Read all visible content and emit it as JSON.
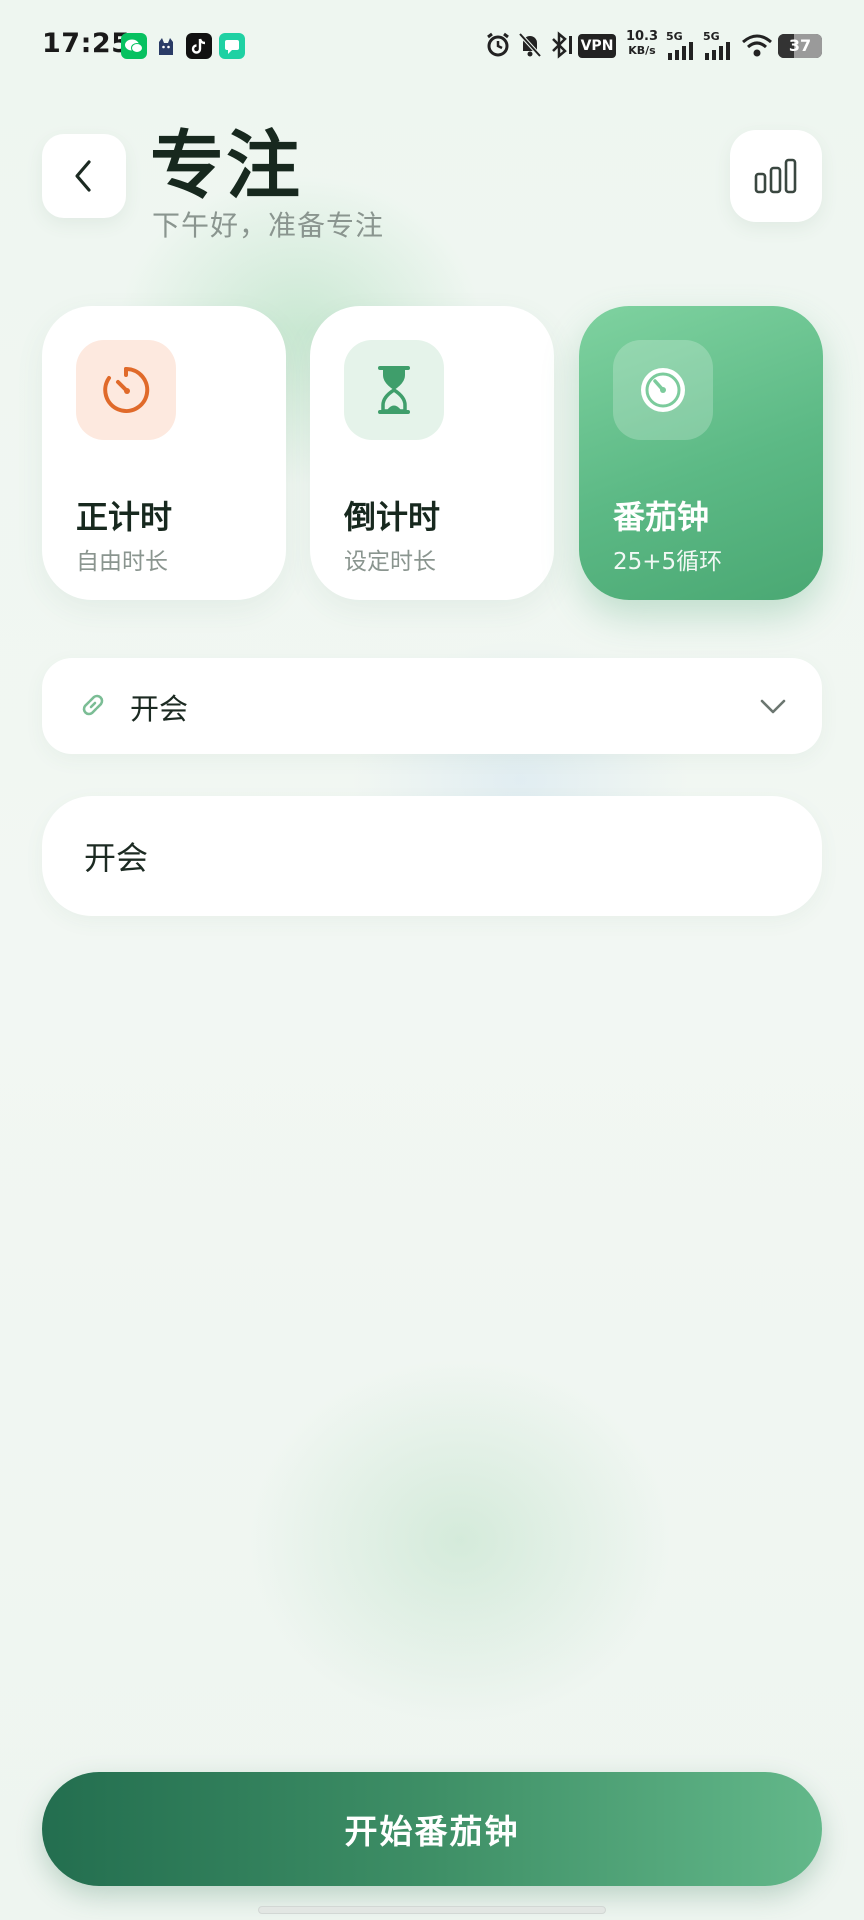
{
  "status_bar": {
    "time": "17:25",
    "vpn_label": "VPN",
    "net_speed_value": "10.3",
    "net_speed_unit": "KB/s",
    "network_label_1": "5G",
    "network_label_2": "5G",
    "battery_level": "37",
    "battery_fraction": 0.37,
    "icons": [
      "wechat-icon",
      "cat-icon",
      "tiktok-icon",
      "message-icon",
      "alarm-icon",
      "mute-bell-icon",
      "bluetooth-icon",
      "signal-icon",
      "signal-icon",
      "wifi-icon",
      "battery-icon"
    ]
  },
  "header": {
    "title": "专注",
    "subtitle": "下午好，准备专注",
    "back_icon": "chevron-left-icon",
    "stats_icon": "bar-chart-icon"
  },
  "modes": [
    {
      "title": "正计时",
      "subtitle": "自由时长",
      "icon": "stopwatch-icon",
      "selected": false
    },
    {
      "title": "倒计时",
      "subtitle": "设定时长",
      "icon": "hourglass-icon",
      "selected": false
    },
    {
      "title": "番茄钟",
      "subtitle": "25+5循环",
      "icon": "timer-icon",
      "selected": true
    }
  ],
  "linked_task": {
    "value": "开会",
    "icon": "link-icon",
    "chevron_icon": "chevron-down-icon"
  },
  "task_input": {
    "value": "开会"
  },
  "start_button": {
    "label": "开始番茄钟"
  },
  "colors": {
    "accent": "#4aa873",
    "accent_dark": "#236e4f",
    "orange": "#e8722e",
    "text": "#17281e",
    "muted": "#8a958f"
  }
}
